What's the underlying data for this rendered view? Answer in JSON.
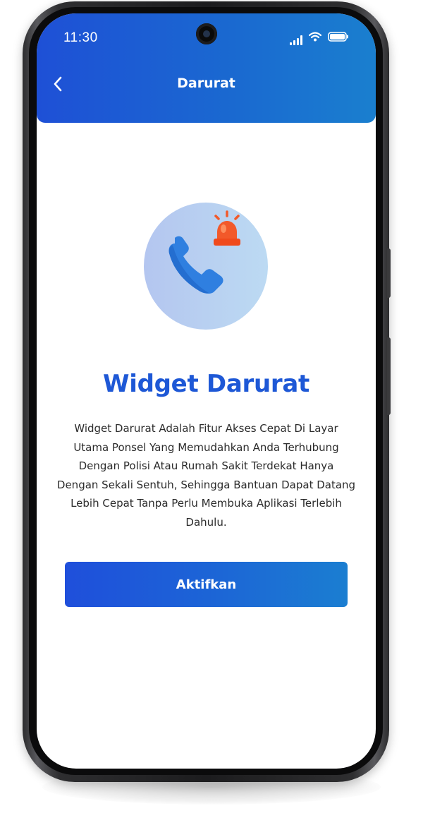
{
  "status_bar": {
    "time": "11:30",
    "icons": [
      "signal-icon",
      "wifi-icon",
      "battery-icon"
    ]
  },
  "header": {
    "title": "Darurat",
    "back_icon": "chevron-left-icon"
  },
  "main": {
    "illustration_icons": [
      "phone-icon",
      "siren-icon"
    ],
    "heading": "Widget Darurat",
    "description": "Widget Darurat Adalah Fitur Akses Cepat Di Layar Utama Ponsel Yang Memudahkan Anda Terhubung Dengan Polisi Atau Rumah Sakit Terdekat Hanya Dengan Sekali Sentuh, Sehingga Bantuan Dapat Datang Lebih Cepat Tanpa Perlu Membuka Aplikasi Terlebih Dahulu.",
    "activate_label": "Aktifkan"
  },
  "colors": {
    "primary": "#1e58d6",
    "primary_gradient_end": "#1b7ed1",
    "siren": "#f2592a",
    "phone": "#2f7fe0"
  }
}
